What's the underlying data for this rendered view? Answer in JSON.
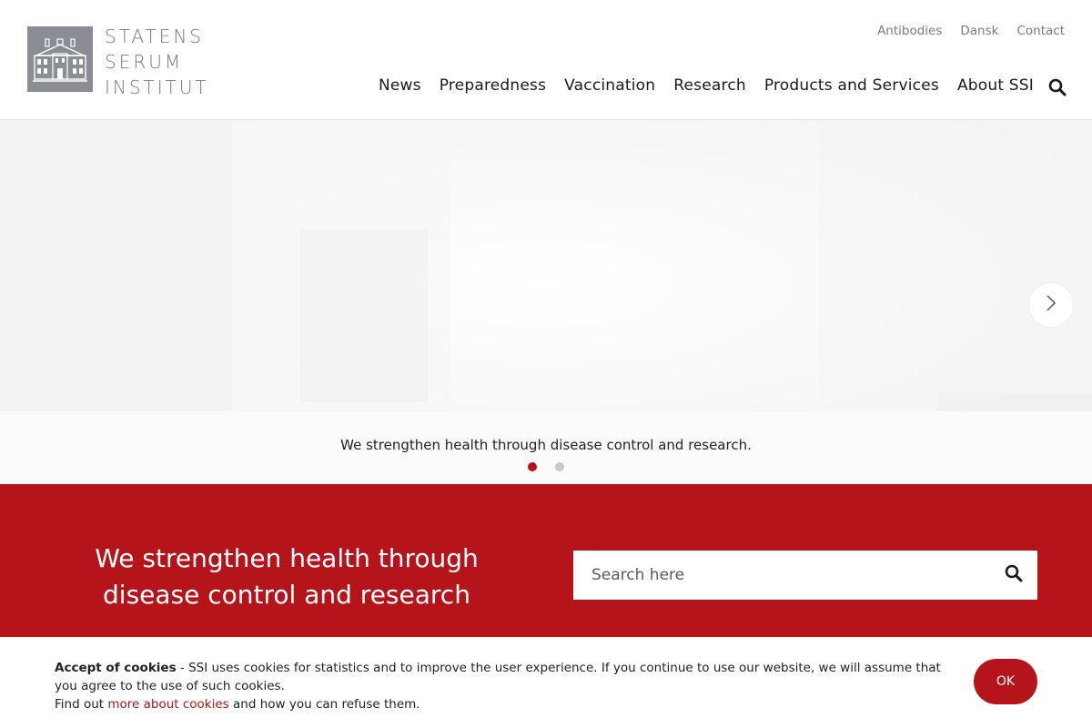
{
  "brand": {
    "logo_lines": [
      "STATENS",
      "SERUM",
      "INSTITUT"
    ],
    "logo_icon": "building-icon",
    "colors": {
      "accent": "#b5141a",
      "logo_gray": "#8a8d93"
    }
  },
  "util_nav": [
    {
      "label": "Antibodies"
    },
    {
      "label": "Dansk"
    },
    {
      "label": "Contact"
    }
  ],
  "main_nav": [
    {
      "label": "News"
    },
    {
      "label": "Preparedness"
    },
    {
      "label": "Vaccination"
    },
    {
      "label": "Research"
    },
    {
      "label": "Products and Services"
    },
    {
      "label": "About SSI"
    }
  ],
  "header_search_icon": "search-icon",
  "hero": {
    "caption": "We strengthen health through disease control and research.",
    "slides": 2,
    "active_slide": 1,
    "next_icon": "chevron-right-icon"
  },
  "band": {
    "title_line1": "We strengthen health through",
    "title_line2": "disease control and research",
    "search_placeholder": "Search here",
    "search_icon": "search-icon"
  },
  "cookie": {
    "heading": "Accept of cookies",
    "body": " - SSI uses cookies for statistics and to improve the user experience. If you continue to use our website, we will assume that you agree to the use of such cookies.",
    "find_out_prefix": "Find out ",
    "link_text": "more about cookies",
    "find_out_suffix": " and how you can refuse them.",
    "ok_label": "OK"
  }
}
